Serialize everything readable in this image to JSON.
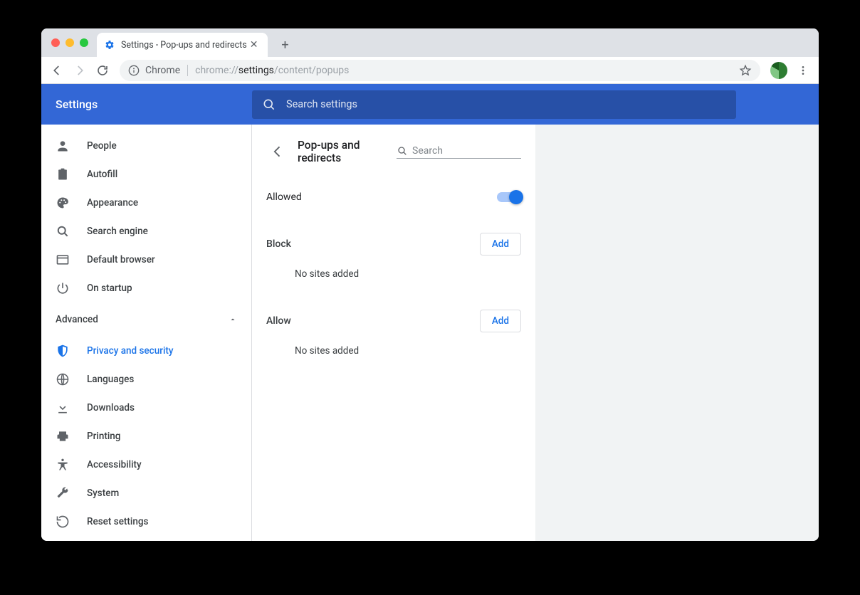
{
  "tab": {
    "title": "Settings - Pop-ups and redirects"
  },
  "omnibox": {
    "host_label": "Chrome",
    "url_pre": "chrome://",
    "url_bold": "settings",
    "url_post": "/content/popups"
  },
  "header": {
    "title": "Settings",
    "search_placeholder": "Search settings"
  },
  "sidebar": {
    "advanced_label": "Advanced",
    "items": [
      {
        "label": "People"
      },
      {
        "label": "Autofill"
      },
      {
        "label": "Appearance"
      },
      {
        "label": "Search engine"
      },
      {
        "label": "Default browser"
      },
      {
        "label": "On startup"
      }
    ],
    "adv_items": [
      {
        "label": "Privacy and security"
      },
      {
        "label": "Languages"
      },
      {
        "label": "Downloads"
      },
      {
        "label": "Printing"
      },
      {
        "label": "Accessibility"
      },
      {
        "label": "System"
      },
      {
        "label": "Reset settings"
      }
    ]
  },
  "page": {
    "title": "Pop-ups and redirects",
    "search_placeholder": "Search",
    "allowed_label": "Allowed",
    "allowed_state": true,
    "block_section": {
      "label": "Block",
      "add": "Add",
      "empty": "No sites added"
    },
    "allow_section": {
      "label": "Allow",
      "add": "Add",
      "empty": "No sites added"
    }
  }
}
